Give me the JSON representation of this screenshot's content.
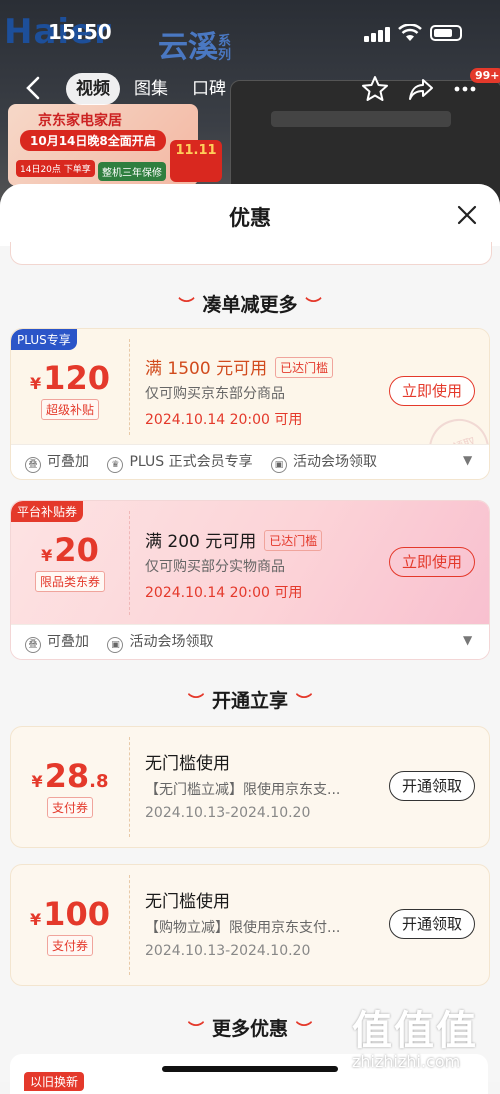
{
  "status_bar": {
    "time": "15:50"
  },
  "background": {
    "brand": "Haier",
    "series": "云溪",
    "series_sub": "系列",
    "promo_line1": "京东家电家居",
    "promo_line2": "10月14日晚8全面开启",
    "promo_tag1": "14日20点 下单享",
    "promo_tag2": "整机三年保修",
    "double11": "11.11"
  },
  "topnav": {
    "tabs": [
      {
        "label": "视频",
        "active": true
      },
      {
        "label": "图集",
        "active": false
      },
      {
        "label": "口碑",
        "active": false
      }
    ],
    "cart_badge": "99+"
  },
  "sheet": {
    "title": "优惠",
    "sections": [
      {
        "title": "凑单减更多",
        "coupons": [
          {
            "ribbon": "PLUS专享",
            "ribbon_color": "#2b55c8",
            "amount": "120",
            "amount_dec": "",
            "tag": "超级补贴",
            "title": "满 1500 元可用",
            "reached": "已达门槛",
            "desc": "仅可购买京东部分商品",
            "date": "2024.10.14 20:00 可用",
            "button": "立即使用",
            "stamp": "已领取",
            "footer": [
              "可叠加",
              "PLUS 正式会员专享",
              "活动会场领取"
            ]
          },
          {
            "ribbon": "平台补贴券",
            "ribbon_color": "#e4392b",
            "amount": "20",
            "amount_dec": "",
            "tag": "限品类东券",
            "title": "满 200 元可用",
            "reached": "已达门槛",
            "desc": "仅可购买部分实物商品",
            "date": "2024.10.14 20:00 可用",
            "button": "立即使用",
            "footer": [
              "可叠加",
              "活动会场领取"
            ]
          }
        ]
      },
      {
        "title": "开通立享",
        "coupons": [
          {
            "amount": "28",
            "amount_dec": ".8",
            "tag": "支付券",
            "title": "无门槛使用",
            "desc": "【无门槛立减】限使用京东支...",
            "date": "2024.10.13-2024.10.20",
            "button": "开通领取"
          },
          {
            "amount": "100",
            "amount_dec": "",
            "tag": "支付券",
            "title": "无门槛使用",
            "desc": "【购物立减】限使用京东支付...",
            "date": "2024.10.13-2024.10.20",
            "button": "开通领取"
          }
        ]
      },
      {
        "title": "更多优惠",
        "peek_ribbon": "以旧换新"
      }
    ]
  },
  "watermark": {
    "big": "值值值",
    "small": "zhizhizhi.com"
  }
}
